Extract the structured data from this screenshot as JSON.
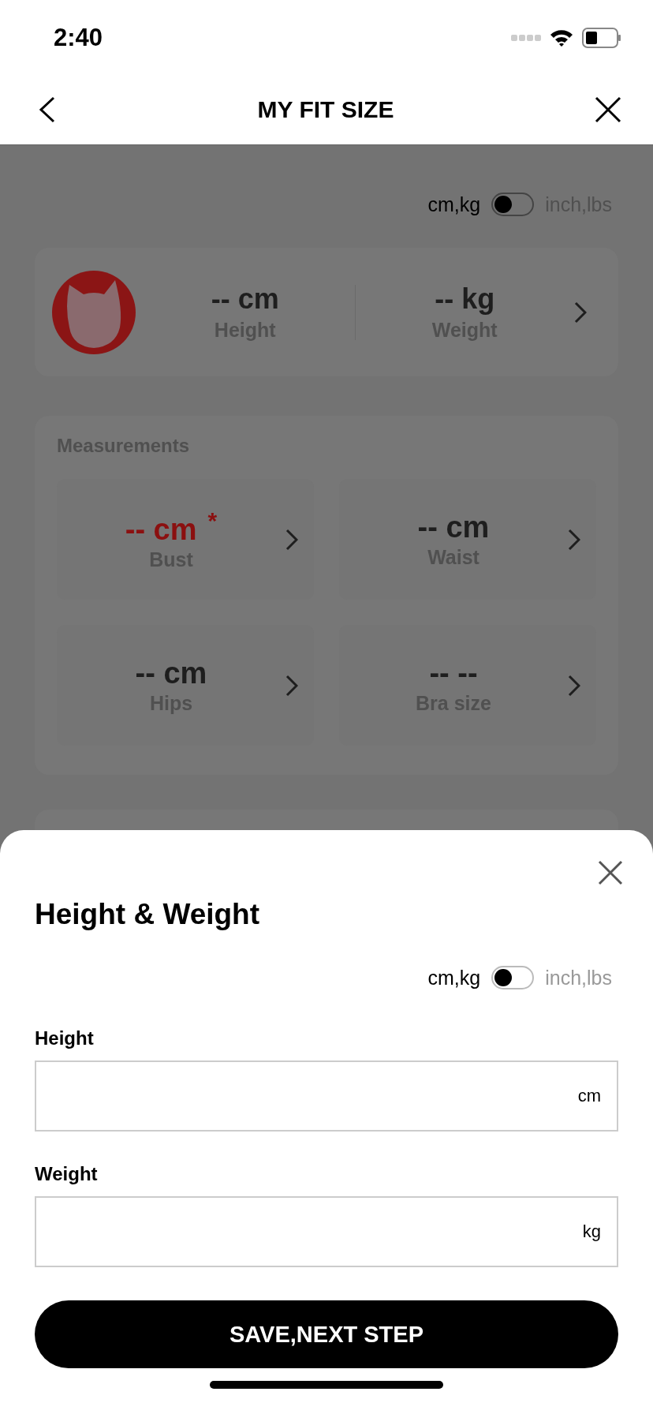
{
  "status_bar": {
    "time": "2:40"
  },
  "nav": {
    "title": "MY FIT SIZE"
  },
  "unit_toggle": {
    "left_label": "cm,kg",
    "right_label": "inch,lbs",
    "on": false
  },
  "profile": {
    "stats": [
      {
        "value": "-- cm",
        "label": "Height"
      },
      {
        "value": "-- kg",
        "label": "Weight"
      }
    ]
  },
  "measurements": {
    "title": "Measurements",
    "items": [
      {
        "value": "-- cm",
        "label": "Bust",
        "required": true,
        "required_mark": "*"
      },
      {
        "value": "-- cm",
        "label": "Waist",
        "required": false
      },
      {
        "value": "-- cm",
        "label": "Hips",
        "required": false
      },
      {
        "value": "-- --",
        "label": "Bra size",
        "required": false
      }
    ]
  },
  "sheet": {
    "title": "Height & Weight",
    "unit_toggle": {
      "left_label": "cm,kg",
      "right_label": "inch,lbs",
      "on": false
    },
    "fields": [
      {
        "label": "Height",
        "unit": "cm"
      },
      {
        "label": "Weight",
        "unit": "kg"
      }
    ],
    "button": "SAVE,NEXT STEP"
  }
}
